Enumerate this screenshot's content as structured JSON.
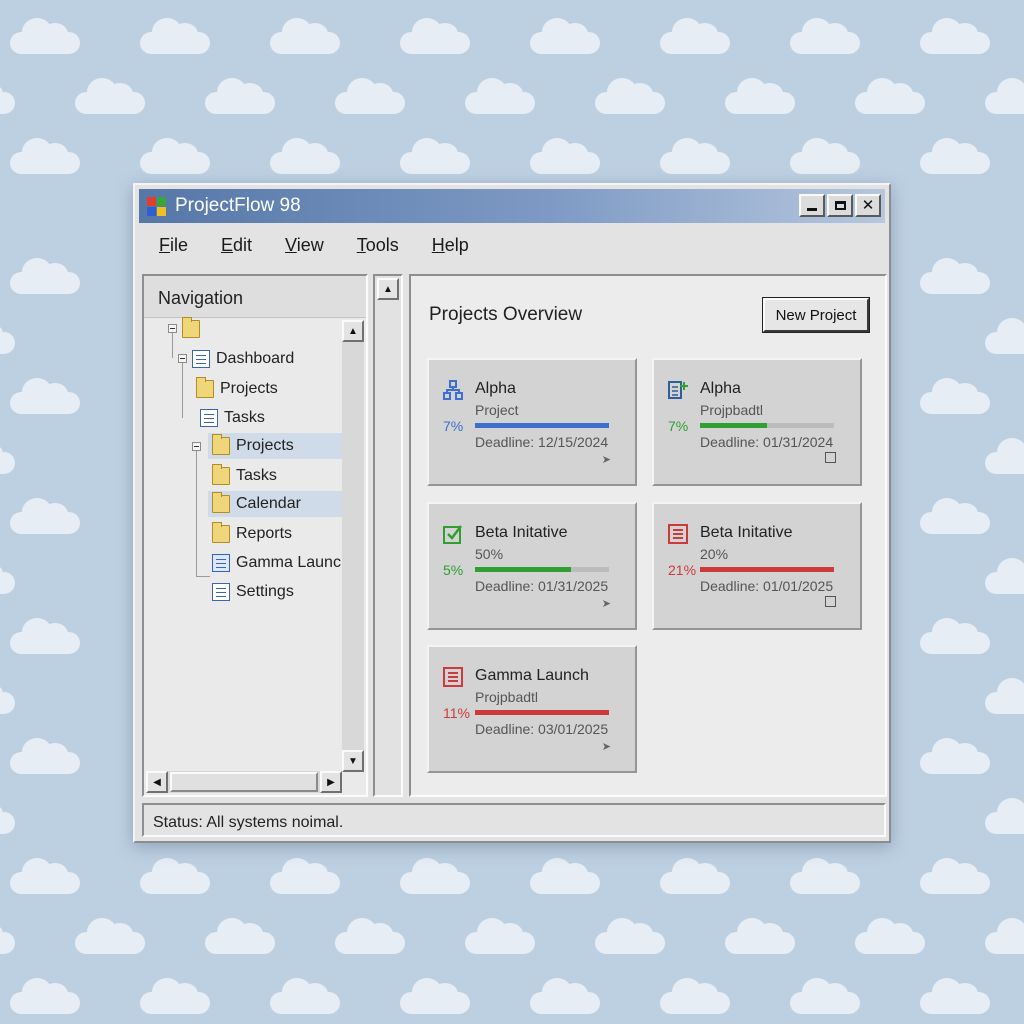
{
  "window": {
    "title": "ProjectFlow 98"
  },
  "menu": [
    {
      "accel": "F",
      "rest": "ile"
    },
    {
      "accel": "E",
      "rest": "dit"
    },
    {
      "accel": "V",
      "rest": "iew"
    },
    {
      "accel": "T",
      "rest": "ools"
    },
    {
      "accel": "H",
      "rest": "elp"
    }
  ],
  "nav": {
    "header": "Navigation",
    "items": [
      {
        "label": "",
        "icon": "folder-icon"
      },
      {
        "label": "Dashboard",
        "icon": "document-icon"
      },
      {
        "label": "Projects",
        "icon": "folder-icon"
      },
      {
        "label": "Tasks",
        "icon": "document-icon"
      },
      {
        "label": "Projects",
        "icon": "folder-icon",
        "selected": true
      },
      {
        "label": "Tasks",
        "icon": "folder-icon"
      },
      {
        "label": "Calendar",
        "icon": "folder-icon",
        "selected": true
      },
      {
        "label": "Reports",
        "icon": "folder-icon"
      },
      {
        "label": "Gamma Launch",
        "icon": "calendar-icon"
      },
      {
        "label": "Settings",
        "icon": "document-icon"
      }
    ]
  },
  "content": {
    "title": "Projects Overview",
    "new_project_label": "New Project",
    "cards": [
      {
        "title": "Alpha",
        "subtitle": "Project",
        "percent_label": "7%",
        "progress": 1.0,
        "color": "#3c6fd0",
        "deadline": "Deadline: 12/15/2024",
        "icon": "org-chart-icon",
        "corner_icon": "arrow-icon"
      },
      {
        "title": "Alpha",
        "subtitle": "Projpbadtl",
        "percent_label": "7%",
        "progress": 0.5,
        "color": "#2fa02f",
        "deadline": "Deadline: 01/31/2024",
        "icon": "list-add-icon",
        "corner_icon": "square-icon"
      },
      {
        "title": "Beta Initative",
        "subtitle": "50%",
        "percent_label": "5%",
        "progress": 0.72,
        "color": "#2fa02f",
        "deadline": "Deadline: 01/31/2025",
        "icon": "checkbox-icon",
        "corner_icon": "arrow-icon"
      },
      {
        "title": "Beta Initative",
        "subtitle": "20%",
        "percent_label": "21%",
        "progress": 1.0,
        "color": "#cc3b3b",
        "deadline": "Deadline: 01/01/2025",
        "icon": "list-icon",
        "corner_icon": "square-icon"
      },
      {
        "title": "Gamma Launch",
        "subtitle": "Projpbadtl",
        "percent_label": "11%",
        "progress": 1.0,
        "color": "#cc3b3b",
        "deadline": "Deadline: 03/01/2025",
        "icon": "list-icon",
        "corner_icon": "arrow-icon"
      }
    ]
  },
  "status": {
    "text": "Status: All systems noimal."
  }
}
